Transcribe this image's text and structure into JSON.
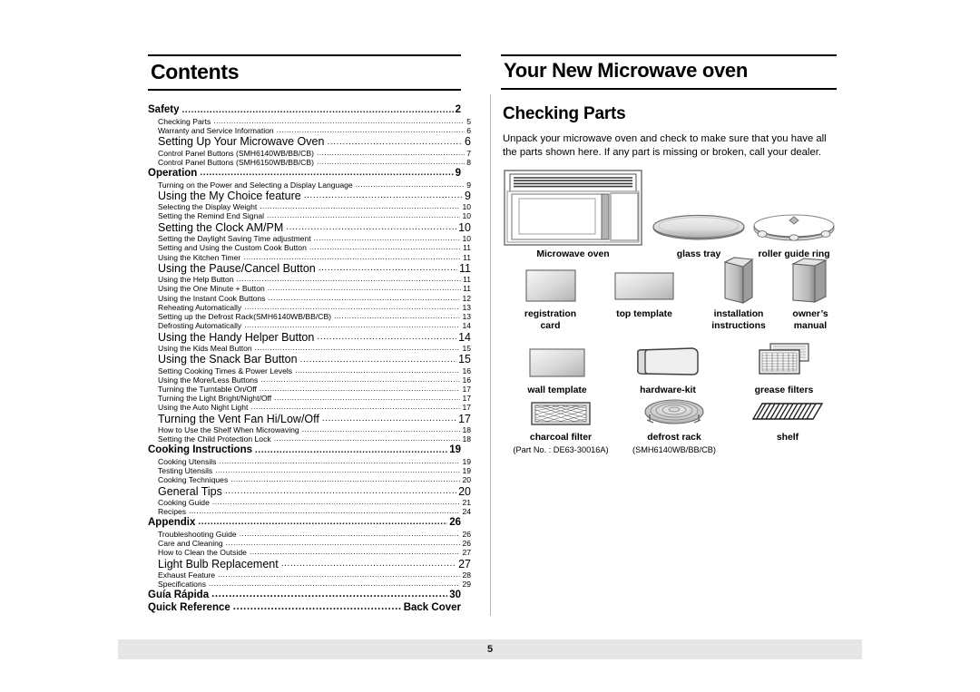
{
  "page": {
    "number": "5"
  },
  "left": {
    "title": "Contents",
    "entries": [
      {
        "level": "h",
        "text": "Safety",
        "page": "2"
      },
      {
        "level": "s",
        "text": "Checking Parts",
        "page": "5"
      },
      {
        "level": "s",
        "text": "Warranty and Service Information",
        "page": "6"
      },
      {
        "level": "b",
        "text": "Setting Up Your Microwave Oven",
        "page": "6"
      },
      {
        "level": "s",
        "text": "Control Panel Buttons (SMH6140WB/BB/CB)",
        "page": "7"
      },
      {
        "level": "s",
        "text": "Control Panel Buttons (SMH6150WB/BB/CB)",
        "page": "8"
      },
      {
        "level": "h",
        "text": "Operation",
        "page": "9"
      },
      {
        "level": "s",
        "text": "Turning on the Power and Selecting a Display Language",
        "page": "9"
      },
      {
        "level": "b",
        "text": "Using the My Choice feature",
        "page": "9"
      },
      {
        "level": "s",
        "text": "Selecting the Display Weight",
        "page": "10"
      },
      {
        "level": "s",
        "text": "Setting the Remind End Signal",
        "page": "10"
      },
      {
        "level": "b",
        "text": "Setting the Clock AM/PM",
        "page": "10"
      },
      {
        "level": "s",
        "text": "Setting the Daylight Saving Time adjustment",
        "page": "10"
      },
      {
        "level": "s",
        "text": "Setting and Using the Custom Cook Button",
        "page": "11"
      },
      {
        "level": "s",
        "text": "Using the Kitchen Timer",
        "page": "11"
      },
      {
        "level": "b",
        "text": "Using the Pause/Cancel Button",
        "page": "11"
      },
      {
        "level": "s",
        "text": "Using the Help Button",
        "page": "11"
      },
      {
        "level": "s",
        "text": "Using the One Minute + Button",
        "page": "11"
      },
      {
        "level": "s",
        "text": "Using the Instant Cook Buttons",
        "page": "12"
      },
      {
        "level": "s",
        "text": "Reheating Automatically",
        "page": "13"
      },
      {
        "level": "s",
        "text": "Setting up the Defrost Rack(SMH6140WB/BB/CB)",
        "page": "13"
      },
      {
        "level": "s",
        "text": "Defrosting Automatically",
        "page": "14"
      },
      {
        "level": "b",
        "text": "Using the Handy Helper Button",
        "page": "14"
      },
      {
        "level": "s",
        "text": "Using the Kids Meal Button",
        "page": "15"
      },
      {
        "level": "b",
        "text": "Using the Snack Bar Button",
        "page": "15"
      },
      {
        "level": "s",
        "text": "Setting Cooking Times & Power Levels",
        "page": "16"
      },
      {
        "level": "s",
        "text": "Using the More/Less Buttons",
        "page": "16"
      },
      {
        "level": "s",
        "text": "Turning the Turntable On/Off",
        "page": "17"
      },
      {
        "level": "s",
        "text": "Turning the  Light Bright/Night/Off",
        "page": "17"
      },
      {
        "level": "s",
        "text": "Using the Auto Night Light",
        "page": "17"
      },
      {
        "level": "b",
        "text": "Turning the Vent Fan Hi/Low/Off",
        "page": "17"
      },
      {
        "level": "s",
        "text": "How to Use the Shelf When Microwaving",
        "page": "18"
      },
      {
        "level": "s",
        "text": "Setting the Child Protection Lock",
        "page": "18"
      },
      {
        "level": "h",
        "text": "Cooking Instructions",
        "page": "19"
      },
      {
        "level": "s",
        "text": "Cooking Utensils",
        "page": "19"
      },
      {
        "level": "s",
        "text": "Testing Utensils",
        "page": "19"
      },
      {
        "level": "s",
        "text": "Cooking Techniques",
        "page": "20"
      },
      {
        "level": "b",
        "text": "General Tips",
        "page": "20"
      },
      {
        "level": "s",
        "text": "Cooking Guide",
        "page": "21"
      },
      {
        "level": "s",
        "text": "Recipes",
        "page": "24"
      },
      {
        "level": "h",
        "text": "Appendix",
        "page": "26"
      },
      {
        "level": "s",
        "text": "Troubleshooting Guide",
        "page": "26"
      },
      {
        "level": "s",
        "text": "Care and Cleaning",
        "page": "26"
      },
      {
        "level": "s",
        "text": "How to Clean the Outside",
        "page": "27"
      },
      {
        "level": "b",
        "text": "Light Bulb Replacement",
        "page": "27"
      },
      {
        "level": "s",
        "text": "Exhaust Feature",
        "page": "28"
      },
      {
        "level": "s",
        "text": "Specifications",
        "page": "29"
      },
      {
        "level": "h2",
        "text": "Guía Rápida ",
        "page": "30"
      },
      {
        "level": "h2",
        "text": "Quick Reference ",
        "page": "Back Cover"
      }
    ]
  },
  "right": {
    "title": "Your New Microwave oven",
    "subtitle": "Checking Parts",
    "intro": "Unpack your microwave oven and check to make sure that you have all the parts shown here. If any part is missing or broken, call your dealer.",
    "parts": [
      {
        "id": "microwave-oven",
        "caption": "Microwave oven",
        "sub": ""
      },
      {
        "id": "glass-tray",
        "caption": "glass tray",
        "sub": ""
      },
      {
        "id": "roller-guide-ring",
        "caption": "roller guide ring",
        "sub": ""
      },
      {
        "id": "registration-card",
        "caption": "registration\ncard",
        "sub": ""
      },
      {
        "id": "top-template",
        "caption": "top template",
        "sub": ""
      },
      {
        "id": "installation-instructions",
        "caption": "installation\ninstructions",
        "sub": ""
      },
      {
        "id": "owners-manual",
        "caption": "owner’s\nmanual",
        "sub": ""
      },
      {
        "id": "wall-template",
        "caption": "wall template",
        "sub": ""
      },
      {
        "id": "hardware-kit",
        "caption": "hardware-kit",
        "sub": ""
      },
      {
        "id": "grease-filters",
        "caption": "grease filters",
        "sub": ""
      },
      {
        "id": "charcoal-filter",
        "caption": "charcoal filter",
        "sub": "(Part No. : DE63-30016A)"
      },
      {
        "id": "defrost-rack",
        "caption": "defrost rack",
        "sub": "(SMH6140WB/BB/CB)"
      },
      {
        "id": "shelf",
        "caption": "shelf",
        "sub": ""
      }
    ],
    "labels": {
      "microwave_oven": "Microwave oven",
      "glass_tray": "glass tray",
      "roller_guide_ring": "roller guide ring",
      "registration_card_l1": "registration",
      "registration_card_l2": "card",
      "top_template": "top template",
      "installation_l1": "installation",
      "installation_l2": "instructions",
      "owners_manual_l1": "owner’s",
      "owners_manual_l2": "manual",
      "wall_template": "wall template",
      "hardware_kit": "hardware-kit",
      "grease_filters": "grease filters",
      "charcoal_filter": "charcoal filter",
      "charcoal_filter_part": "(Part No. : DE63-30016A)",
      "defrost_rack": "defrost rack",
      "defrost_rack_model": "(SMH6140WB/BB/CB)",
      "shelf": "shelf"
    }
  },
  "colors": {
    "rule": "#000000",
    "divider": "#b8b8b8",
    "footer_band": "#e6e6e6",
    "art_stroke": "#5a5a5a",
    "art_fill_light": "#efefef",
    "art_fill_mid": "#c9c9c9"
  }
}
